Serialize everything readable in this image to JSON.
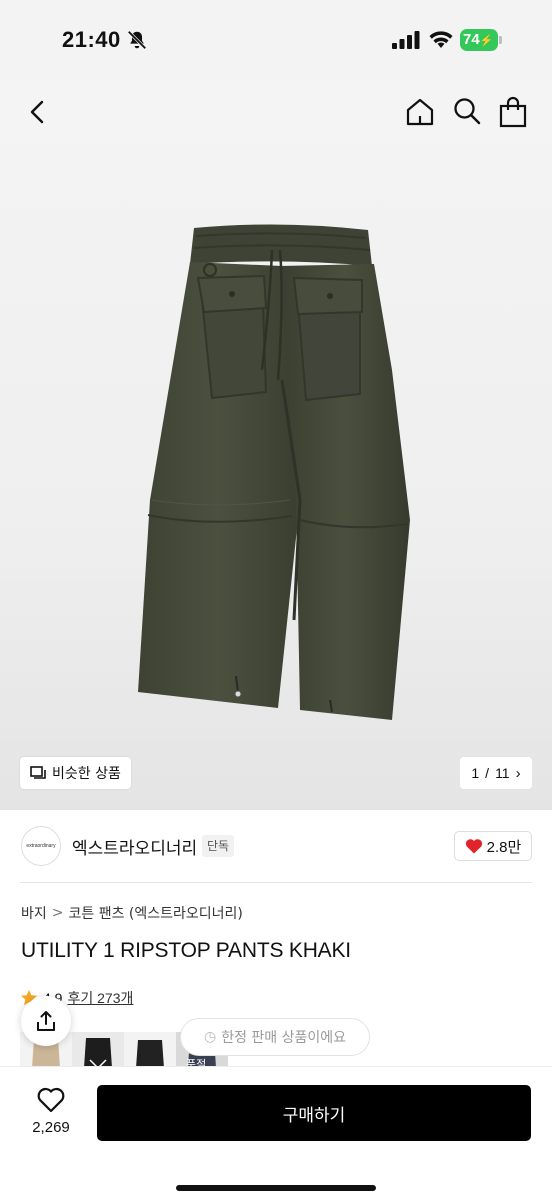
{
  "status_bar": {
    "time": "21:40",
    "battery": "74"
  },
  "nav": {
    "icons": [
      "back-icon",
      "home-icon",
      "search-icon",
      "bag-icon"
    ]
  },
  "gallery": {
    "similar_label": "비슷한 상품",
    "page_current": "1",
    "page_separator": "/",
    "page_total": "11"
  },
  "brand": {
    "logo_text": "extraordinary",
    "name": "엑스트라오디너리",
    "badge": "단독",
    "like_count": "2.8만",
    "colors": {
      "heart": "#e0242b"
    }
  },
  "breadcrumb": {
    "items": [
      "바지",
      "코튼 팬츠 (엑스트라오디너리)"
    ],
    "separator": ">"
  },
  "product": {
    "title": "UTILITY 1 RIPSTOP PANTS KHAKI",
    "rating": "4.9",
    "review_text": "후기 273개",
    "limited_text": "한정 판매 상품이에요",
    "swatch_soldout": "품절",
    "colors": {
      "star": "#f5a623",
      "garment": "#45493a"
    }
  },
  "bottom": {
    "wish_count": "2,269",
    "buy_label": "구매하기"
  }
}
